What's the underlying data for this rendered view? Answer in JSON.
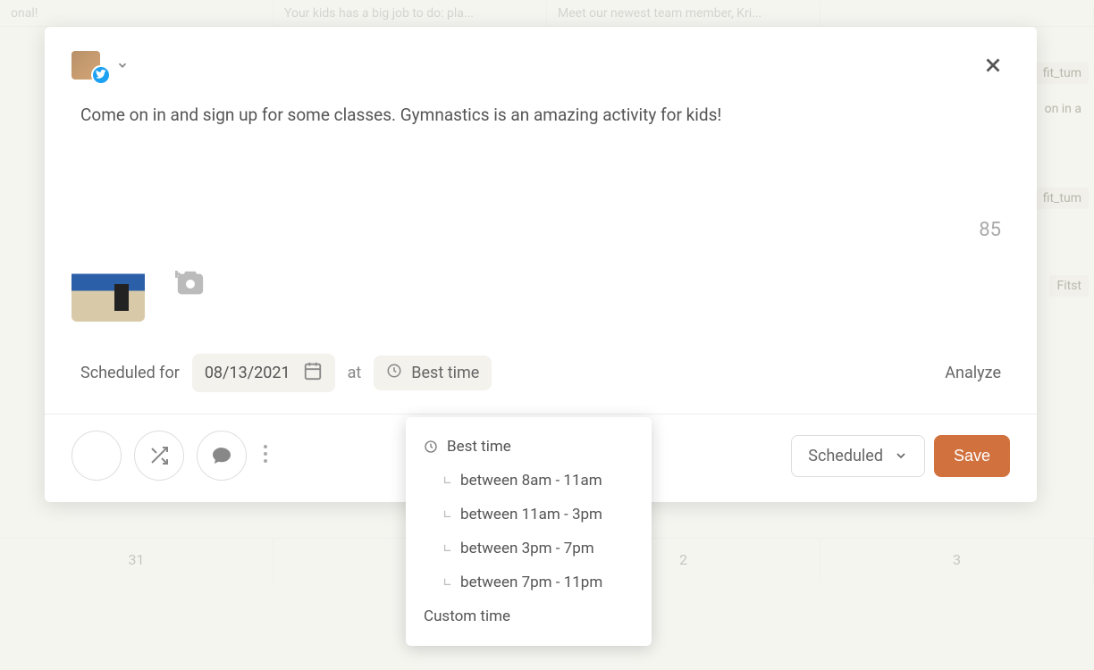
{
  "bg": {
    "row1": {
      "c1": "onal!",
      "c2": "Your kids has a big job to do: pla...",
      "c3": "Meet our newest team member, Kri..."
    },
    "tags": {
      "t1": "fit_tum",
      "t2": "on in a",
      "t3": "fit_tum",
      "t4": "Fitst"
    },
    "days": {
      "d31": "31",
      "d2": "2",
      "d3": "3"
    }
  },
  "compose": {
    "text": "Come on in and sign up for some classes. Gymnastics is an amazing activity for kids!",
    "char_count": "85"
  },
  "schedule": {
    "label": "Scheduled for",
    "date": "08/13/2021",
    "at": "at",
    "time_label": "Best time",
    "analyze": "Analyze"
  },
  "footer": {
    "status": "Scheduled",
    "save": "Save"
  },
  "dropdown": {
    "best": "Best time",
    "opt1": "between 8am - 11am",
    "opt2": "between 11am - 3pm",
    "opt3": "between 3pm - 7pm",
    "opt4": "between 7pm - 11pm",
    "custom": "Custom time"
  }
}
